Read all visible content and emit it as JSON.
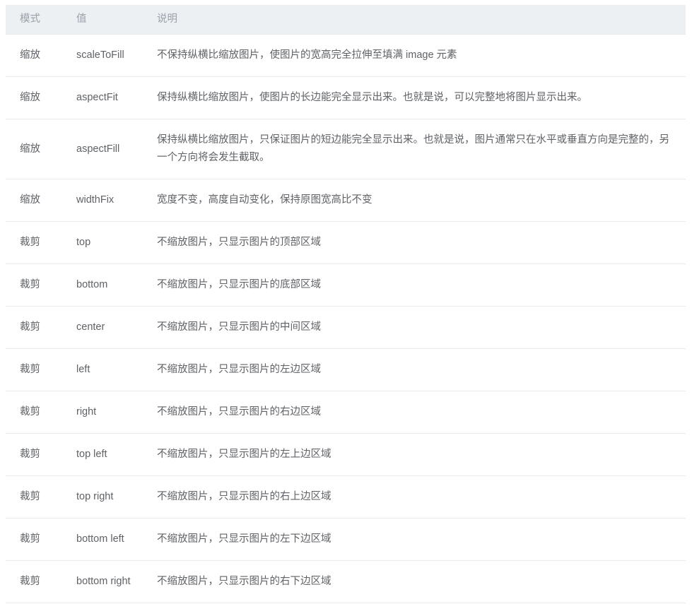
{
  "table": {
    "columns": [
      {
        "key": "mode",
        "label": "模式"
      },
      {
        "key": "value",
        "label": "值"
      },
      {
        "key": "desc",
        "label": "说明"
      }
    ],
    "rows": [
      {
        "mode": "缩放",
        "value": "scaleToFill",
        "desc": "不保持纵横比缩放图片，使图片的宽高完全拉伸至填满 image 元素"
      },
      {
        "mode": "缩放",
        "value": "aspectFit",
        "desc": "保持纵横比缩放图片，使图片的长边能完全显示出来。也就是说，可以完整地将图片显示出来。"
      },
      {
        "mode": "缩放",
        "value": "aspectFill",
        "desc": "保持纵横比缩放图片，只保证图片的短边能完全显示出来。也就是说，图片通常只在水平或垂直方向是完整的，另一个方向将会发生截取。"
      },
      {
        "mode": "缩放",
        "value": "widthFix",
        "desc": "宽度不变，高度自动变化，保持原图宽高比不变"
      },
      {
        "mode": "裁剪",
        "value": "top",
        "desc": "不缩放图片，只显示图片的顶部区域"
      },
      {
        "mode": "裁剪",
        "value": "bottom",
        "desc": "不缩放图片，只显示图片的底部区域"
      },
      {
        "mode": "裁剪",
        "value": "center",
        "desc": "不缩放图片，只显示图片的中间区域"
      },
      {
        "mode": "裁剪",
        "value": "left",
        "desc": "不缩放图片，只显示图片的左边区域"
      },
      {
        "mode": "裁剪",
        "value": "right",
        "desc": "不缩放图片，只显示图片的右边区域"
      },
      {
        "mode": "裁剪",
        "value": "top left",
        "desc": "不缩放图片，只显示图片的左上边区域"
      },
      {
        "mode": "裁剪",
        "value": "top right",
        "desc": "不缩放图片，只显示图片的右上边区域"
      },
      {
        "mode": "裁剪",
        "value": "bottom left",
        "desc": "不缩放图片，只显示图片的左下边区域"
      },
      {
        "mode": "裁剪",
        "value": "bottom right",
        "desc": "不缩放图片，只显示图片的右下边区域"
      }
    ]
  },
  "colors": {
    "header_background": "#ecf0f3",
    "header_text": "#9aa1ab",
    "body_text": "#5f6266",
    "divider": "#e9eaec",
    "page_background": "#ffffff"
  }
}
